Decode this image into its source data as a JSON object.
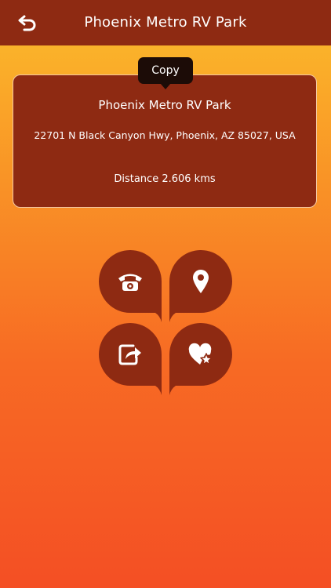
{
  "header": {
    "title": "Phoenix Metro RV Park",
    "back_icon": "back-arrow-icon"
  },
  "tooltip": {
    "label": "Copy"
  },
  "card": {
    "name": "Phoenix Metro RV Park",
    "address": "22701 N Black Canyon Hwy, Phoenix, AZ 85027, USA",
    "distance": "Distance 2.606 kms"
  },
  "actions": [
    {
      "name": "call",
      "icon": "phone-icon"
    },
    {
      "name": "map",
      "icon": "location-pin-icon"
    },
    {
      "name": "share",
      "icon": "share-icon"
    },
    {
      "name": "favorite",
      "icon": "heart-star-icon"
    }
  ],
  "colors": {
    "bar": "#8e2a12",
    "gradient_top": "#fbbd2b",
    "gradient_bottom": "#f44f24",
    "tooltip": "#1c0c07",
    "card_border": "#f3c7a3"
  }
}
